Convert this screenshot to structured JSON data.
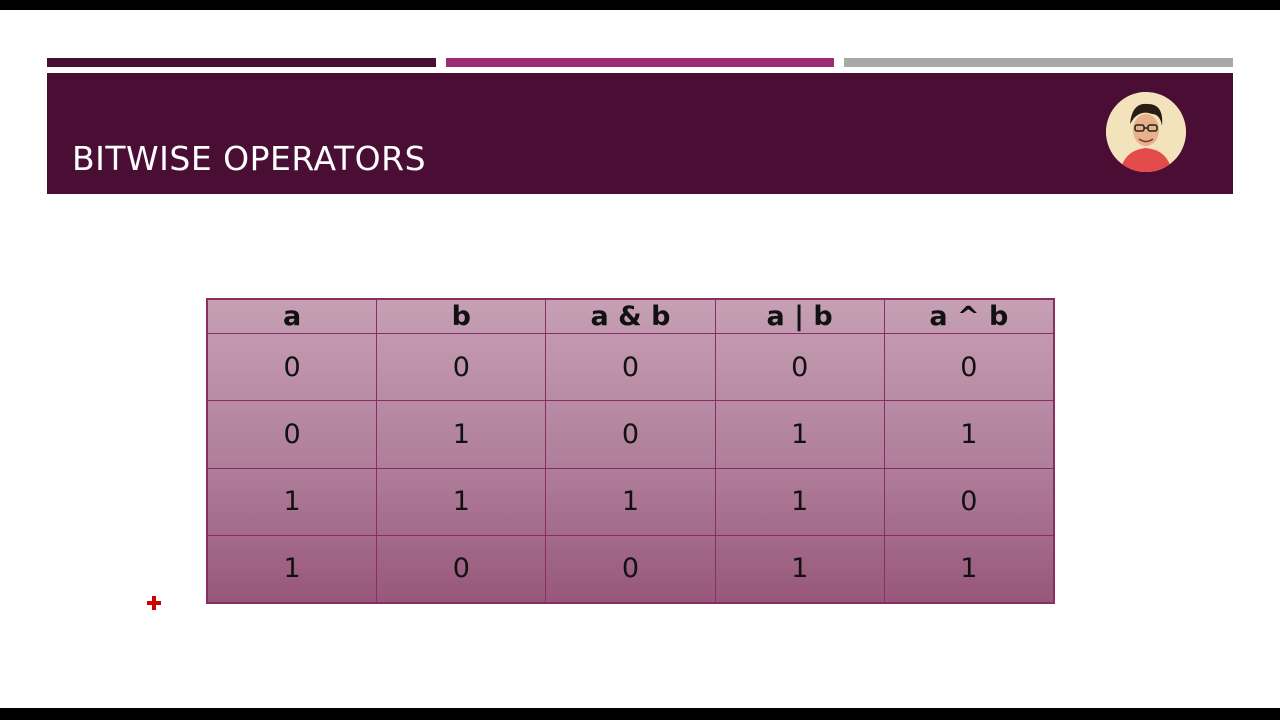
{
  "slide": {
    "title": "BITWISE OPERATORS",
    "colors": {
      "primary": "#4a0e35",
      "secondary": "#9b2c72",
      "tertiary": "#a8a8a8",
      "table_border": "#8a2d62"
    },
    "presenter_avatar_icon": "presenter-avatar"
  },
  "table": {
    "headers": [
      "a",
      "b",
      "a & b",
      "a | b",
      "a ^ b"
    ],
    "rows": [
      [
        "0",
        "0",
        "0",
        "0",
        "0"
      ],
      [
        "0",
        "1",
        "0",
        "1",
        "1"
      ],
      [
        "1",
        "1",
        "1",
        "1",
        "0"
      ],
      [
        "1",
        "0",
        "0",
        "1",
        "1"
      ]
    ]
  },
  "pointer": {
    "icon": "red-cross-pointer-icon",
    "color": "#cc0000"
  }
}
